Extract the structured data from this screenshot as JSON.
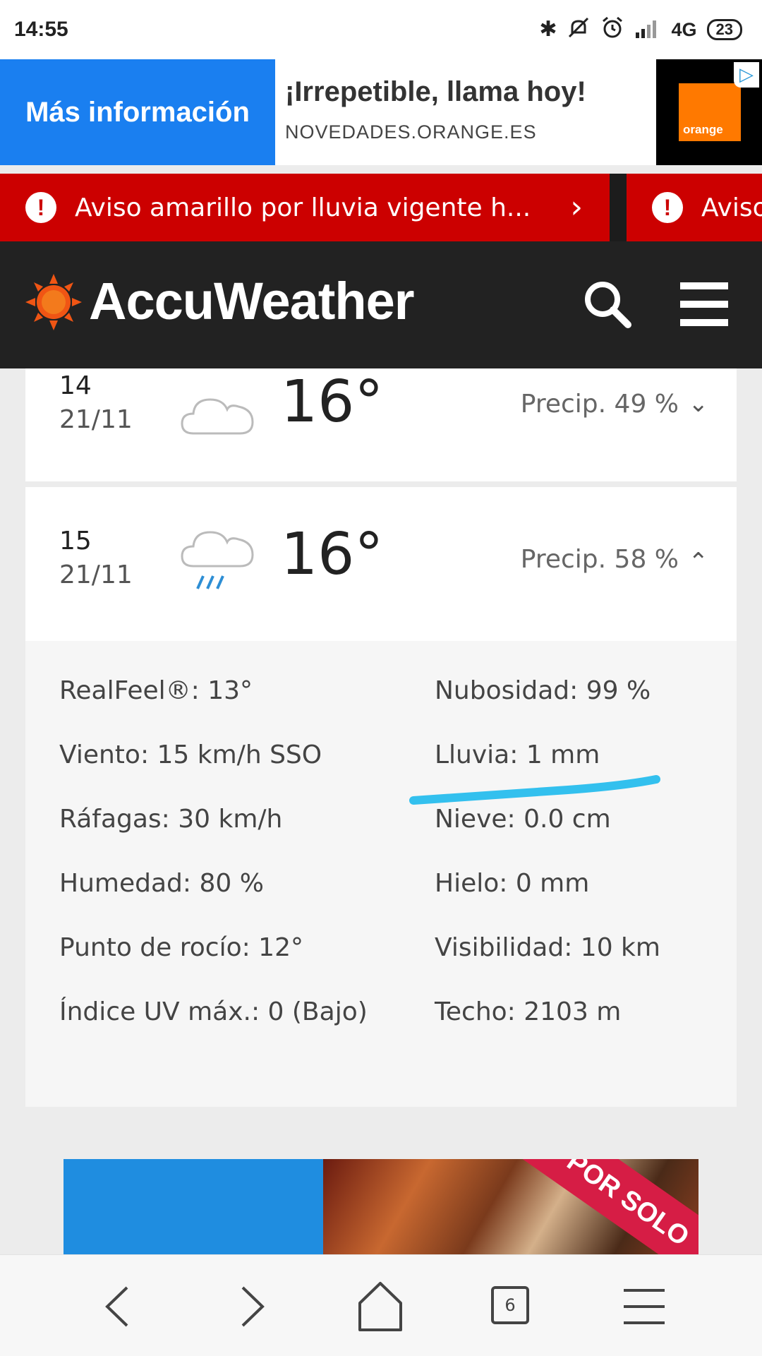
{
  "status_bar": {
    "time": "14:55",
    "network": "4G",
    "battery": "23",
    "icons": [
      "bluetooth-icon",
      "silent-icon",
      "alarm-icon",
      "signal-icon"
    ]
  },
  "ad": {
    "button_label": "Más información",
    "headline": "¡Irrepetible, llama hoy!",
    "url": "NOVEDADES.ORANGE.ES",
    "brand_logo_text": "orange",
    "colors": {
      "button": "#1a7ff0",
      "logo": "#ff7900"
    }
  },
  "alerts": [
    {
      "text": "Aviso amarillo por lluvia vigente h..."
    },
    {
      "text": "Aviso"
    }
  ],
  "header": {
    "brand": "AccuWeather",
    "colors": {
      "background": "#222222",
      "sun": "#f05514"
    }
  },
  "hourly": [
    {
      "hour": "14",
      "date": "21/11",
      "temp": "16°",
      "precip": "Precip. 49 %",
      "icon": "cloud-icon",
      "expanded": false
    },
    {
      "hour": "15",
      "date": "21/11",
      "temp": "16°",
      "precip": "Precip. 58 %",
      "icon": "rain-cloud-icon",
      "expanded": true
    }
  ],
  "details": {
    "left": [
      "RealFeel®: 13°",
      "Viento: 15 km/h SSO",
      "Ráfagas: 30 km/h",
      "Humedad: 80 %",
      "Punto de rocío: 12°",
      "Índice UV máx.: 0 (Bajo)"
    ],
    "right": [
      "Nubosidad: 99 %",
      "Lluvia: 1 mm",
      "Nieve: 0.0 cm",
      "Hielo: 0 mm",
      "Visibilidad: 10 km",
      "Techo: 2103 m"
    ],
    "highlight_color": "#33c0ee"
  },
  "promo": {
    "ribbon_text": "POR SOLO"
  },
  "bottom_nav": {
    "tab_count": "6"
  }
}
